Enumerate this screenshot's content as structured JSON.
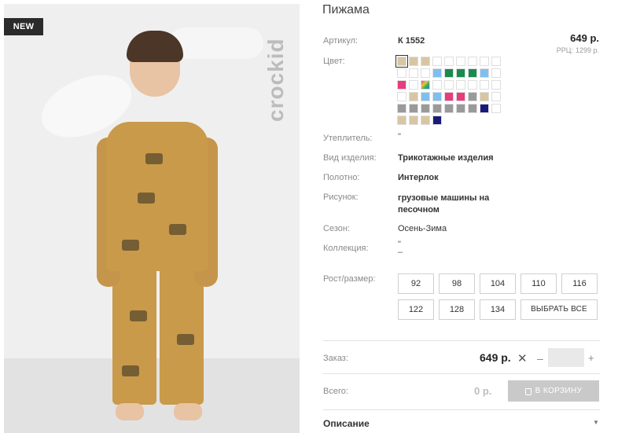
{
  "badge": "NEW",
  "brand": "crockid",
  "product": {
    "title": "Пижама",
    "article_label": "Артикул:",
    "article_value": "К 1552",
    "price": "649 р.",
    "rrp_label": "РРЦ:",
    "rrp_value": "1299 р.",
    "color_label": "Цвет:",
    "swatches": [
      "#d8c6a2",
      "#d8c6a2",
      "#d8c6a2",
      "#ffffff",
      "#ffffff",
      "#ffffff",
      "#ffffff",
      "#ffffff",
      "#ffffff",
      "#ffffff",
      "#ffffff",
      "#ffffff",
      "#7fbfef",
      "#1a8a4e",
      "#1a8a4e",
      "#1a8a4e",
      "#7fbfef",
      "#ffffff",
      "#e83c7c",
      "#ffffff",
      "#multicolor",
      "#ffffff",
      "#ffffff",
      "#ffffff",
      "#ffffff",
      "#ffffff",
      "#ffffff",
      "#ffffff",
      "#d8c6a2",
      "#7fbfef",
      "#7fbfef",
      "#e83c7c",
      "#e83c7c",
      "#9a9a9a",
      "#d8c6a2",
      "#ffffff",
      "#9a9a9a",
      "#9a9a9a",
      "#9a9a9a",
      "#9a9a9a",
      "#9a9a9a",
      "#9a9a9a",
      "#9a9a9a",
      "#1a1a7a",
      "#ffffff",
      "#d8c6a2",
      "#d8c6a2",
      "#d8c6a2",
      "#1a1a7a"
    ],
    "insulation_label": "Утеплитель:",
    "insulation_value": "\"",
    "kind_label": "Вид изделия:",
    "kind_value": "Трикотажные изделия",
    "fabric_label": "Полотно:",
    "fabric_value": "Интерлок",
    "pattern_label": "Рисунок:",
    "pattern_value": "грузовые машины на песочном",
    "season_label": "Сезон:",
    "season_value": "Осень-Зима",
    "collection_label": "Коллекция:",
    "collection_value": "\"\n–",
    "size_label": "Рост/размер:",
    "sizes": [
      "92",
      "98",
      "104",
      "110",
      "116",
      "122",
      "128",
      "134"
    ],
    "select_all": "ВЫБРАТЬ ВСЕ"
  },
  "order": {
    "label": "Заказ:",
    "price": "649 р.",
    "times": "✕",
    "minus": "–",
    "plus": "+",
    "qty_value": ""
  },
  "total": {
    "label": "Всего:",
    "value": "0 р.",
    "cart_button": "В КОРЗИНУ"
  },
  "description": {
    "label": "Описание",
    "chevron": "▼"
  }
}
